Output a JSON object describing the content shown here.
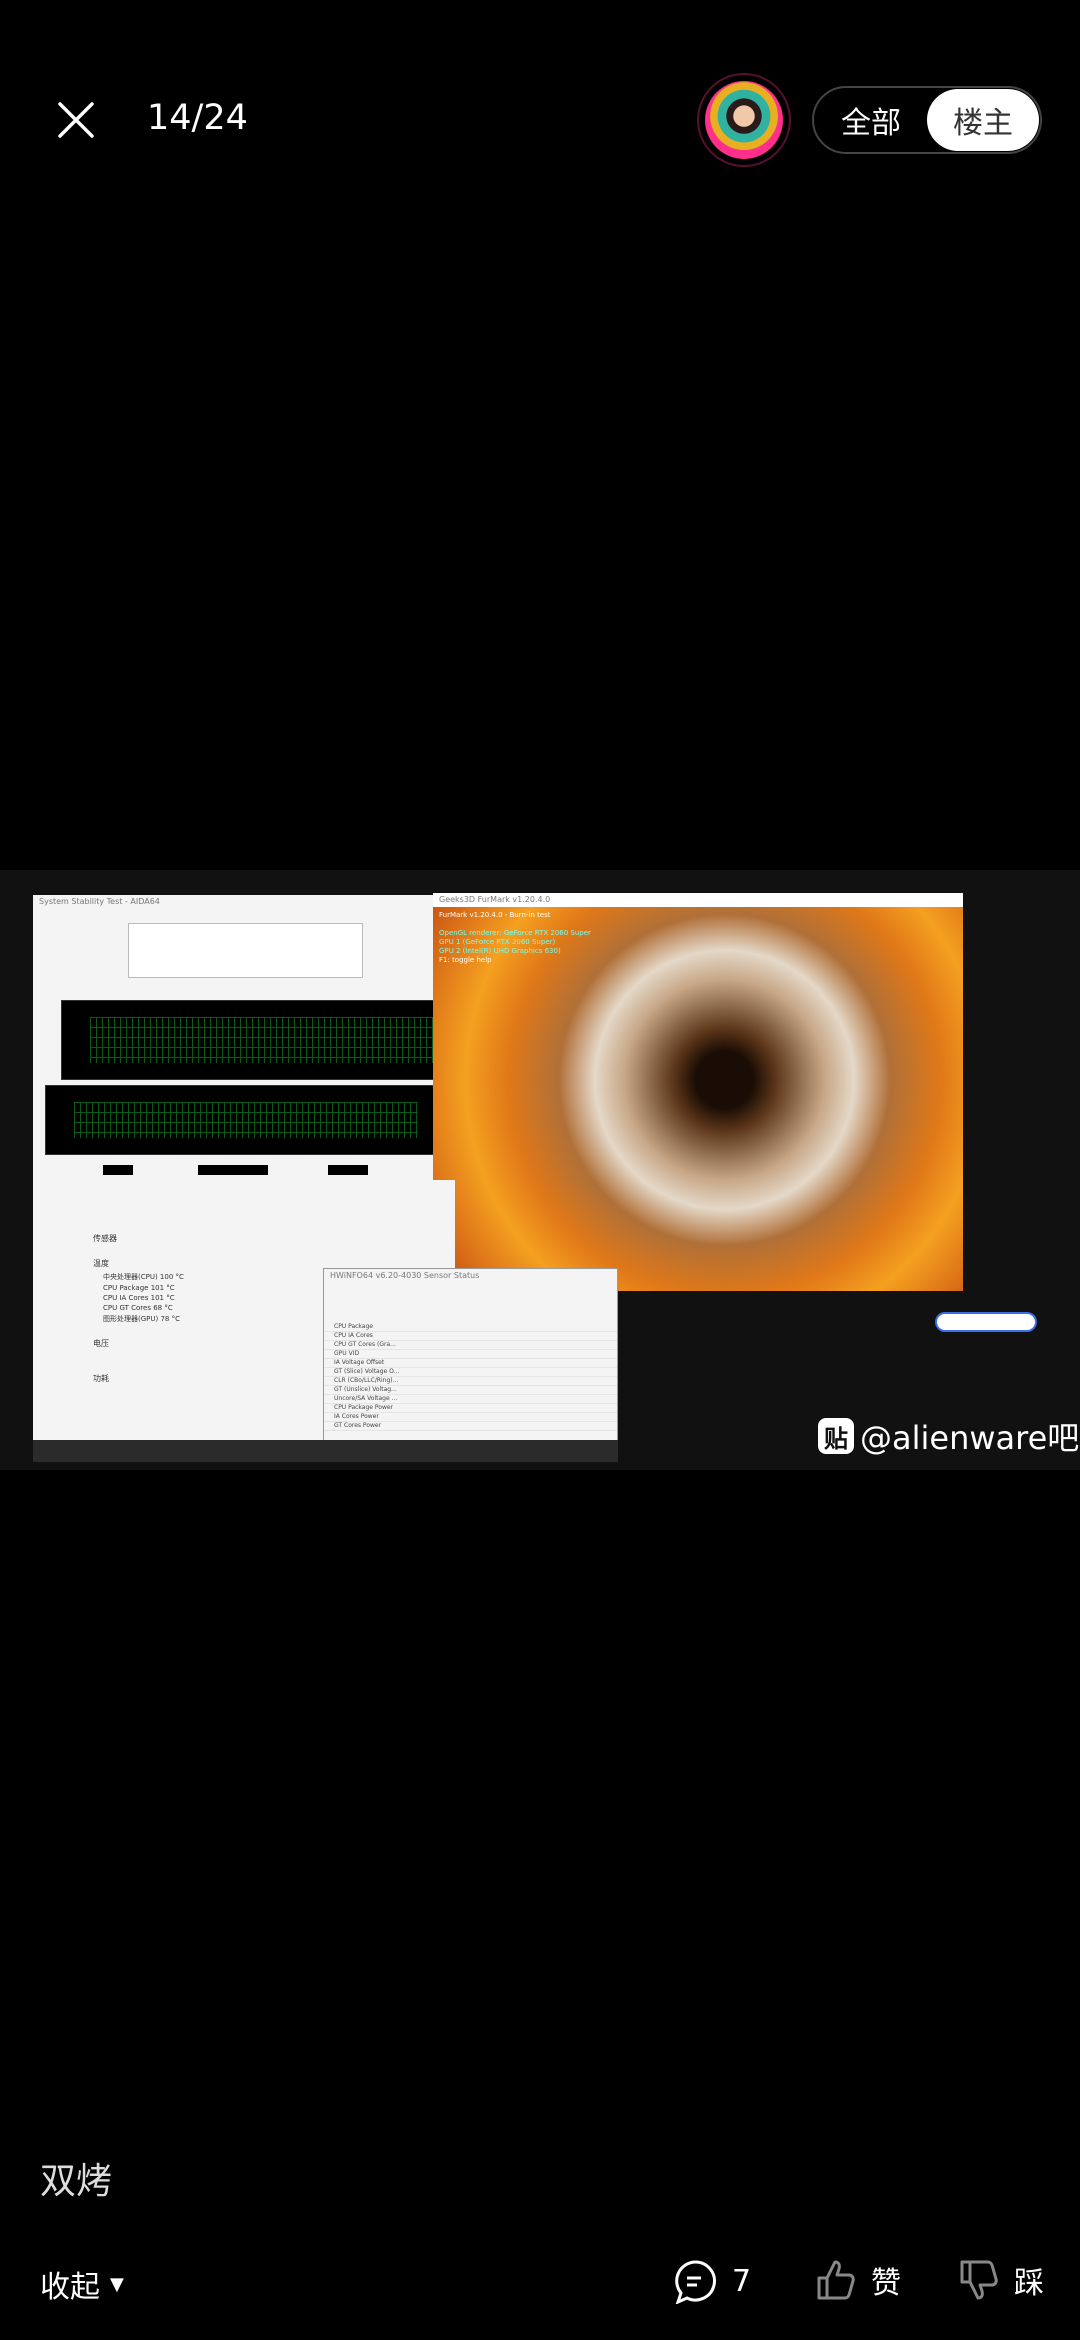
{
  "header": {
    "counter": "14/24",
    "tabs": [
      {
        "label": "全部",
        "selected": false
      },
      {
        "label": "楼主",
        "selected": true
      }
    ]
  },
  "photo": {
    "aida_title": "System Stability Test - AIDA64",
    "furmark_title": "Geeks3D FurMark v1.20.4.0",
    "furmark_lines": [
      "FurMark v1.20.4.0 - Burn-in test",
      "OpenGL renderer: GeForce RTX 2060 Super",
      "GPU 1 (GeForce RTX 2060 Super)",
      "GPU 2 (Intel(R) UHD Graphics 630)",
      "F1: toggle help"
    ],
    "hwinfo_title": "HWiNFO64 v6.20-4030 Sensor Status",
    "hwinfo_rows": [
      "CPU Package",
      "CPU IA Cores",
      "CPU GT Cores (Gra...",
      "GPU VID",
      "IA Voltage Offset",
      "GT (Slice) Voltage O...",
      "CLR (CBo/LLC/Ring)...",
      "GT (Unslice) Voltag...",
      "Uncore/SA Voltage ...",
      "CPU Package Power",
      "IA Cores Power",
      "GT Cores Power"
    ],
    "cn_items": [
      "传感器",
      "温度",
      "中央处理器(CPU)  100 °C",
      "CPU Package  101 °C",
      "CPU IA Cores  101 °C",
      "CPU GT Cores  68 °C",
      "图形处理器(GPU)  78 °C",
      "电压",
      "功耗"
    ],
    "watermark": "@alienware吧",
    "watermark_badge": "贴"
  },
  "caption": "双烤",
  "footer": {
    "collapse": "收起",
    "comments": "7",
    "like": "赞",
    "dislike": "踩"
  }
}
